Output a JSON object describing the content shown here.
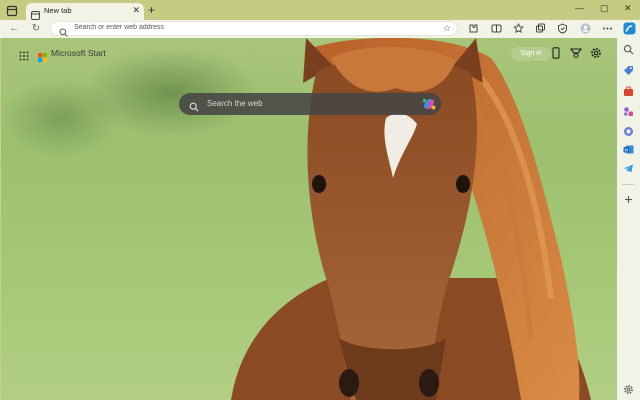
{
  "browser": {
    "tab": {
      "title": "New tab"
    },
    "address_bar": {
      "placeholder": "Search or enter web address"
    }
  },
  "page": {
    "brand": "Microsoft Start",
    "sign_in_label": "Sign in",
    "search": {
      "placeholder": "Search the web"
    }
  },
  "colors": {
    "chrome_bg": "#c5cb82",
    "toolbar_bg": "#f1f3e6",
    "search_bg": "#464646"
  },
  "icons": {
    "toolbar": [
      "back-icon",
      "refresh-icon",
      "favorites-star-icon",
      "extensions-icon",
      "split-screen-icon",
      "favorites-icon",
      "collections-icon",
      "browser-essentials-icon",
      "profile-icon",
      "more-icon",
      "copilot-icon"
    ],
    "sidebar": [
      "search-icon",
      "shopping-tag-icon",
      "tools-icon",
      "games-icon",
      "copilot-icon",
      "outlook-icon",
      "telegram-icon",
      "add-icon",
      "settings-icon"
    ],
    "page": [
      "apps-grid-icon",
      "microsoft-logo-icon",
      "phone-icon",
      "rewards-icon",
      "settings-icon"
    ]
  }
}
